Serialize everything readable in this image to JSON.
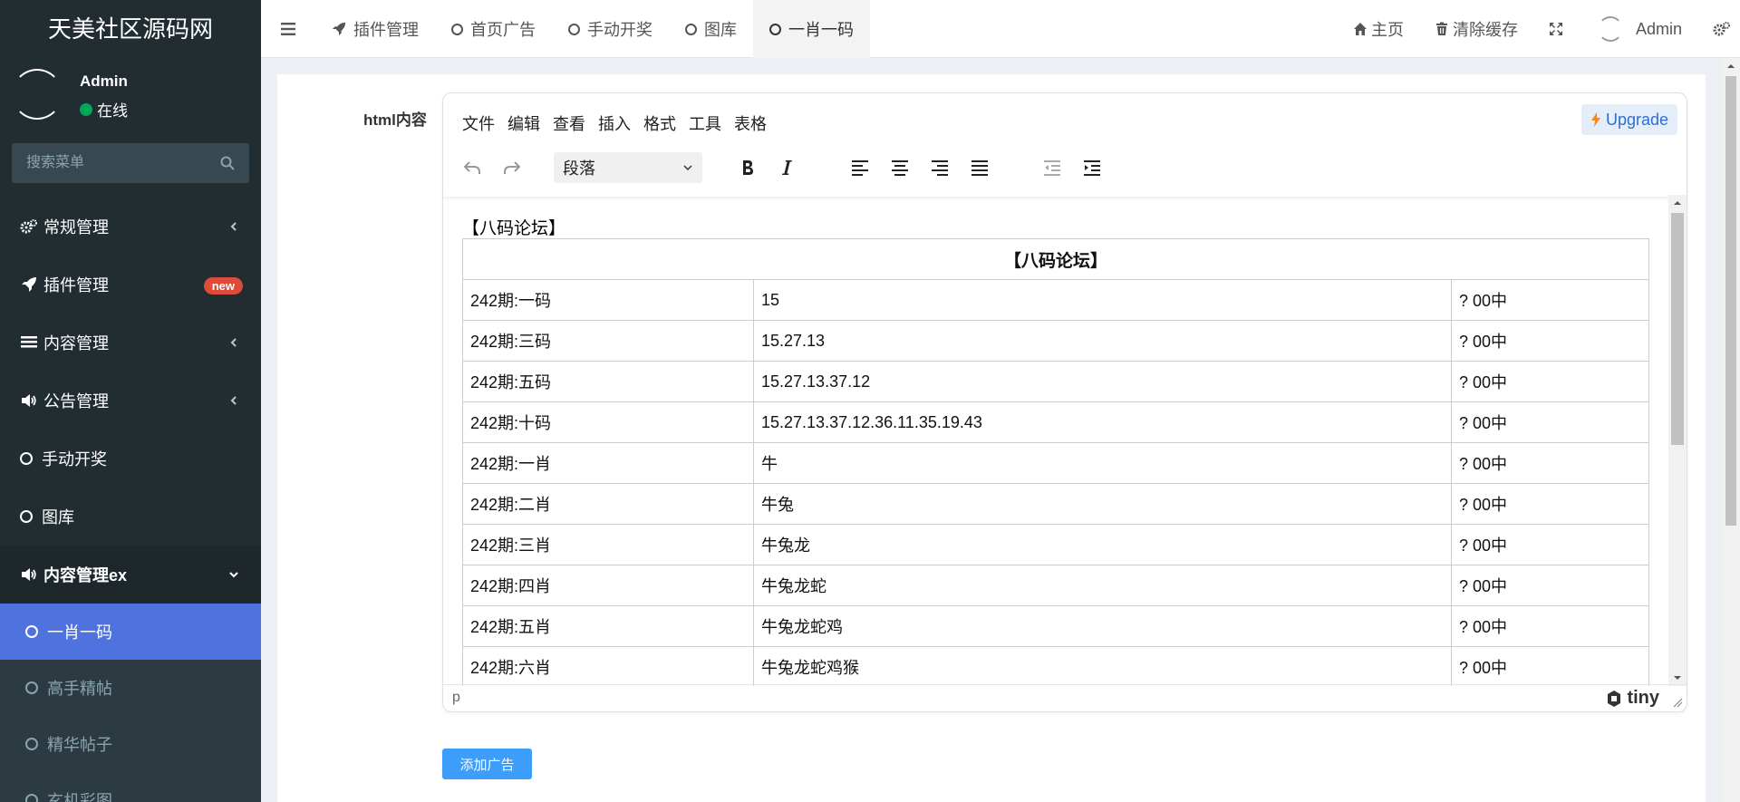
{
  "brand": "天美社区源码网",
  "user": {
    "name": "Admin",
    "status": "在线"
  },
  "search": {
    "placeholder": "搜索菜单"
  },
  "sidebar": {
    "items": [
      {
        "label": "常规管理"
      },
      {
        "label": "插件管理",
        "badge": "new"
      },
      {
        "label": "内容管理"
      },
      {
        "label": "公告管理"
      },
      {
        "label": "手动开奖"
      },
      {
        "label": "图库"
      },
      {
        "label": "内容管理ex"
      }
    ],
    "subitems": [
      {
        "label": "一肖一码"
      },
      {
        "label": "高手精帖"
      },
      {
        "label": "精华帖子"
      },
      {
        "label": "玄机彩图"
      }
    ]
  },
  "tabs": [
    {
      "label": "插件管理"
    },
    {
      "label": "首页广告"
    },
    {
      "label": "手动开奖"
    },
    {
      "label": "图库"
    },
    {
      "label": "一肖一码"
    }
  ],
  "nav": {
    "home": "主页",
    "clear_cache": "清除缓存",
    "admin": "Admin"
  },
  "form": {
    "label": "html内容",
    "submit": "添加广告"
  },
  "editor": {
    "menubar": [
      "文件",
      "编辑",
      "查看",
      "插入",
      "格式",
      "工具",
      "表格"
    ],
    "upgrade": "Upgrade",
    "block_format": "段落",
    "status_path": "p",
    "brand": "tiny",
    "top_text": "【八码论坛】",
    "table_header": "【八码论坛】",
    "rows": [
      {
        "period": "242期:一码",
        "value": "15",
        "result": "?  00中"
      },
      {
        "period": "242期:三码",
        "value": "15.27.13",
        "result": "?  00中"
      },
      {
        "period": "242期:五码",
        "value": "15.27.13.37.12",
        "result": "?  00中"
      },
      {
        "period": "242期:十码",
        "value": "15.27.13.37.12.36.11.35.19.43",
        "result": "?  00中"
      },
      {
        "period": "242期:一肖",
        "value": "牛",
        "result": "?  00中"
      },
      {
        "period": "242期:二肖",
        "value": "牛兔",
        "result": "?  00中"
      },
      {
        "period": "242期:三肖",
        "value": "牛兔龙",
        "result": "?  00中"
      },
      {
        "period": "242期:四肖",
        "value": "牛兔龙蛇",
        "result": "?  00中"
      },
      {
        "period": "242期:五肖",
        "value": "牛兔龙蛇鸡",
        "result": "?  00中"
      },
      {
        "period": "242期:六肖",
        "value": "牛兔龙蛇鸡猴",
        "result": "?  00中"
      }
    ]
  },
  "colors": {
    "sidebar_bg": "#222d32",
    "active_item": "#4e73df",
    "badge": "#dd4b39",
    "primary_button": "#3c9dfb",
    "online": "#00a65a"
  }
}
